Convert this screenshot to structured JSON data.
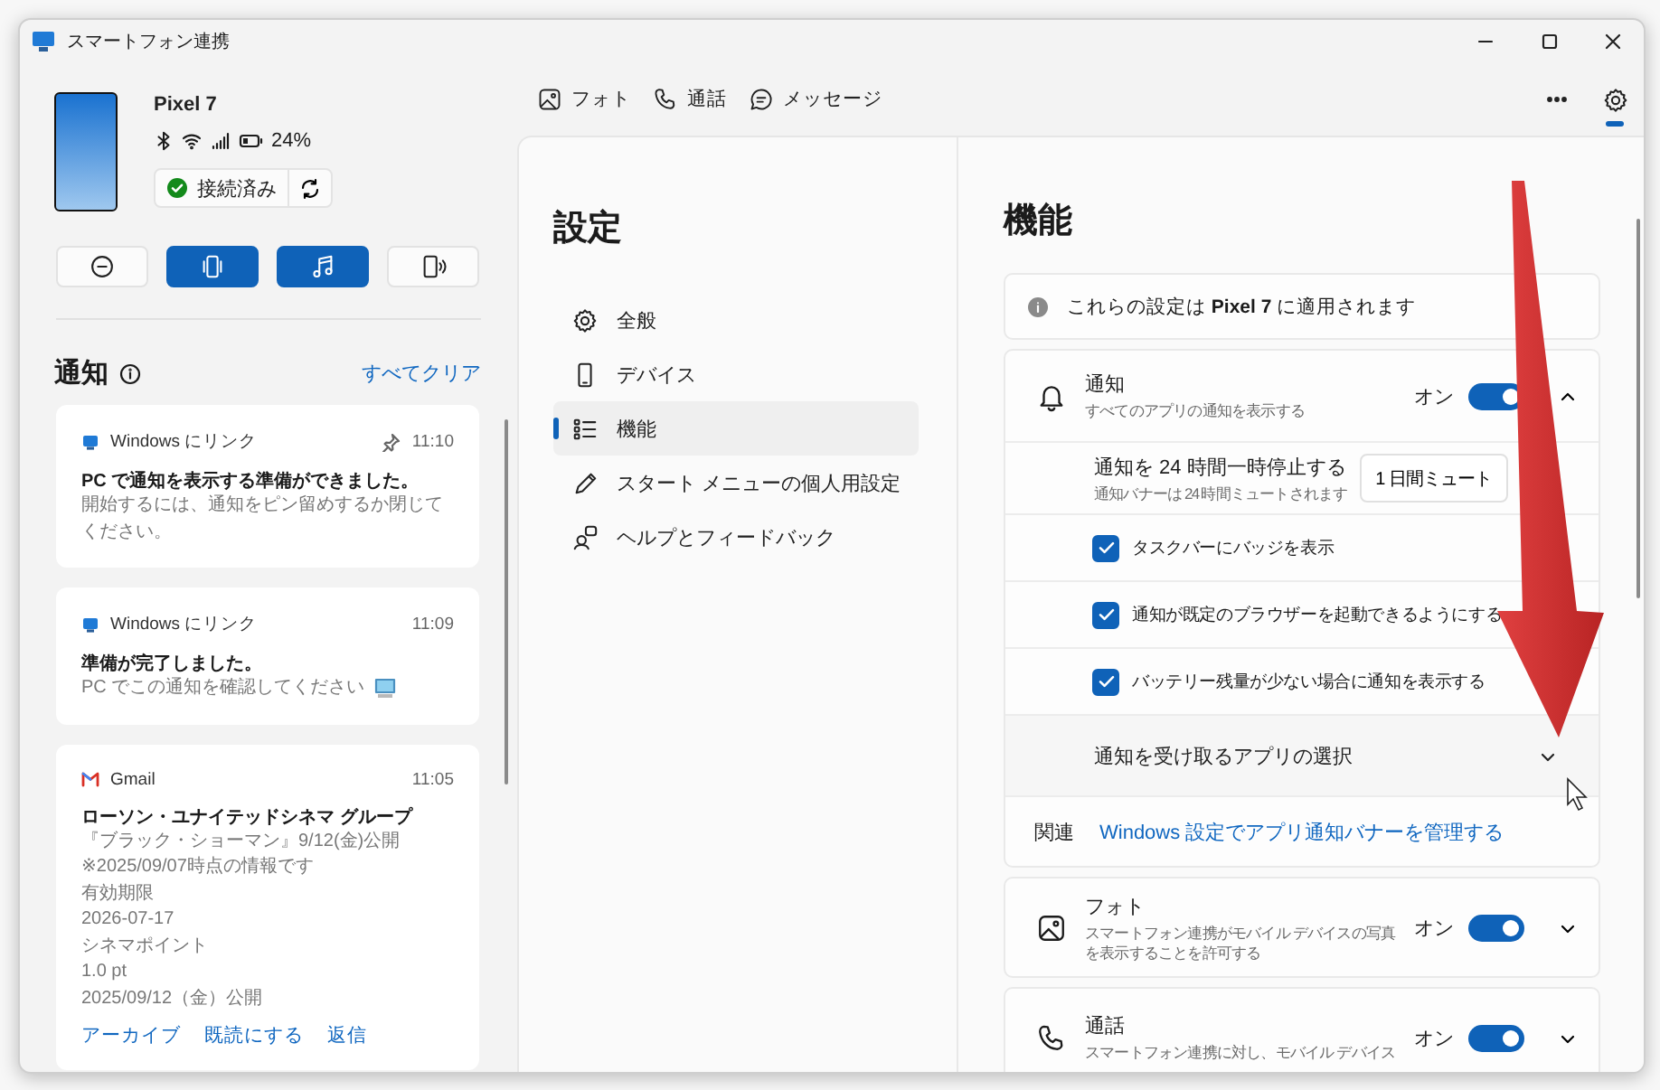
{
  "window": {
    "title": "スマートフォン連携"
  },
  "device": {
    "name": "Pixel 7",
    "battery": "24%",
    "status": "接続済み"
  },
  "quick_actions": [
    {
      "kind": "dnd",
      "selected": false
    },
    {
      "kind": "vibrate",
      "selected": true
    },
    {
      "kind": "media",
      "selected": true
    },
    {
      "kind": "audio",
      "selected": false
    }
  ],
  "notifications": {
    "title": "通知",
    "clear_all": "すべてクリア",
    "items": [
      {
        "kind": "windows",
        "app": "Windows にリンク",
        "time": "11:10",
        "pinned": true,
        "title": "PC で通知を表示する準備ができました。",
        "body": [
          "開始するには、通知をピン留めするか閉じてください。"
        ],
        "body_icon": false
      },
      {
        "kind": "windows",
        "app": "Windows にリンク",
        "time": "11:09",
        "pinned": false,
        "title": "準備が完了しました。",
        "body": [
          "PC でこの通知を確認してください"
        ],
        "body_icon": true
      },
      {
        "kind": "gmail",
        "app": "Gmail",
        "time": "11:05",
        "pinned": false,
        "title": "ローソン・ユナイテッドシネマ グループ",
        "body": [
          "『ブラック・ショーマン』9/12(金)公開",
          "※2025/09/07時点の情報です",
          "有効期限",
          "2026-07-17",
          "シネマポイント",
          "1.0 pt",
          "2025/09/12（金）公開"
        ],
        "body_icon": false,
        "actions": [
          "アーカイブ",
          "既読にする",
          "返信"
        ]
      }
    ]
  },
  "top_nav": {
    "tabs": [
      {
        "kind": "photo",
        "label": "フォト"
      },
      {
        "kind": "call",
        "label": "通話"
      },
      {
        "kind": "message",
        "label": "メッセージ"
      }
    ],
    "settings_selected": true
  },
  "settings": {
    "title": "設定",
    "items": [
      {
        "kind": "gear",
        "label": "全般",
        "selected": false
      },
      {
        "kind": "device",
        "label": "デバイス",
        "selected": false
      },
      {
        "kind": "list",
        "label": "機能",
        "selected": true
      },
      {
        "kind": "pen",
        "label": "スタート メニューの個人用設定",
        "selected": false
      },
      {
        "kind": "help",
        "label": "ヘルプとフィードバック",
        "selected": false
      }
    ]
  },
  "features": {
    "title": "機能",
    "info": "これらの設定は **Pixel 7** に適用されます",
    "notification": {
      "title": "通知",
      "subtitle": "すべてのアプリの通知を表示する",
      "state_label": "オン",
      "on": true,
      "expanded": true,
      "mute": {
        "title": "通知を 24 時間一時停止する",
        "subtitle": "通知バナーは 24 時間ミュートされます",
        "button": "1 日間ミュート"
      },
      "options": [
        {
          "label": "タスクバーにバッジを表示",
          "checked": true
        },
        {
          "label": "通知が既定のブラウザーを起動できるようにする",
          "checked": true
        },
        {
          "label": "バッテリー残量が少ない場合に通知を表示する",
          "checked": true
        }
      ],
      "app_select": "通知を受け取るアプリの選択",
      "related_label": "関連",
      "related_link": "Windows 設定でアプリ通知バナーを管理する"
    },
    "cards": [
      {
        "kind": "photo",
        "title": "フォト",
        "subtitle": "スマートフォン連携がモバイル デバイスの写真を表示することを許可する",
        "state_label": "オン",
        "on": true,
        "expanded": false
      },
      {
        "kind": "call",
        "title": "通話",
        "subtitle": "スマートフォン連携に対し、モバイル デバイス",
        "state_label": "オン",
        "on": true,
        "expanded": false
      }
    ]
  }
}
